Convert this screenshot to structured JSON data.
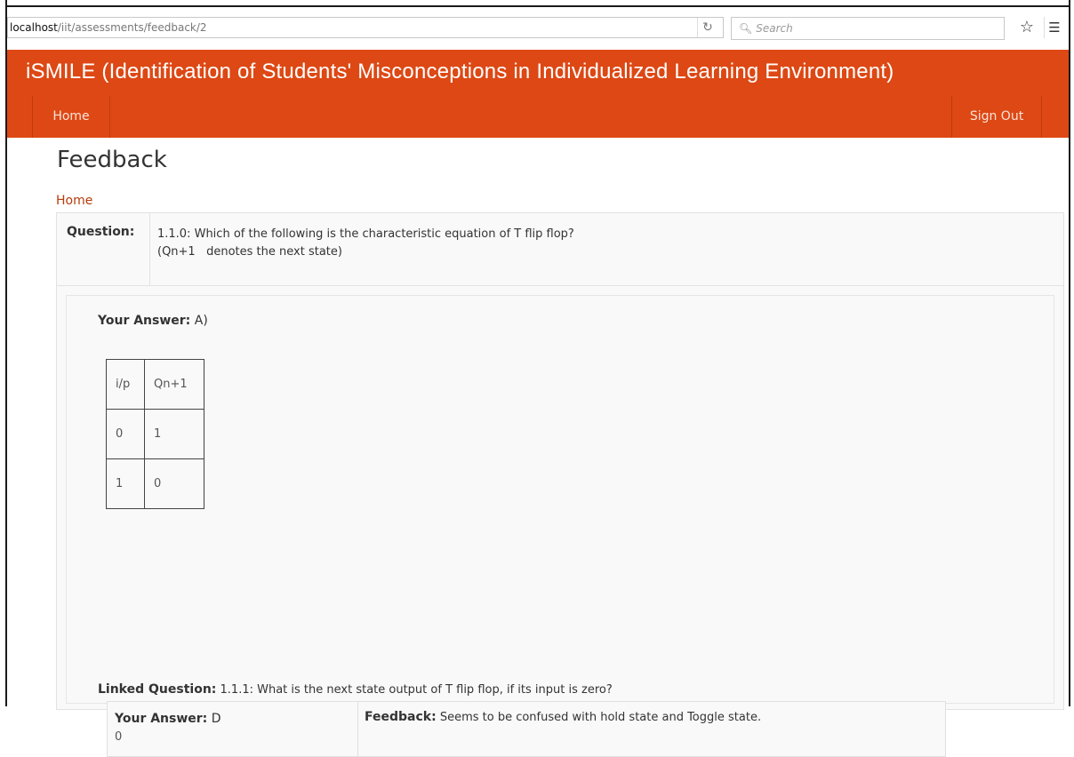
{
  "browser": {
    "url_host": "localhost",
    "url_path": "/iit/assessments/feedback/2",
    "reload_icon": "reload-icon",
    "search_placeholder": "Search",
    "bookmark_icon": "star-icon",
    "reader_icon": "clipboard-icon"
  },
  "header": {
    "brand": "iSMILE (Identification of Students' Misconceptions in Individualized Learning Environment)",
    "nav_home": "Home",
    "nav_signout": "Sign Out",
    "color": "#dd4814"
  },
  "page": {
    "title": "Feedback",
    "breadcrumb": "Home"
  },
  "question": {
    "label": "Question:",
    "line1": "1.1.0: Which of the following is the characteristic equation of T flip flop?",
    "line2": "(Qn+1   denotes the next state)"
  },
  "answer": {
    "label": "Your Answer:",
    "value": "A)",
    "table": {
      "headers": [
        "i/p",
        "Qn+1"
      ],
      "rows": [
        [
          "0",
          "1"
        ],
        [
          "1",
          "0"
        ]
      ]
    }
  },
  "linked": {
    "label": "Linked Question:",
    "text": "1.1.1: What is the next state output of T flip flop, if its input is zero?",
    "answer_label": "Your Answer:",
    "answer_value": "D",
    "answer_detail": "0",
    "feedback_label": "Feedback:",
    "feedback_text": "Seems to be confused with hold state and Toggle state."
  }
}
